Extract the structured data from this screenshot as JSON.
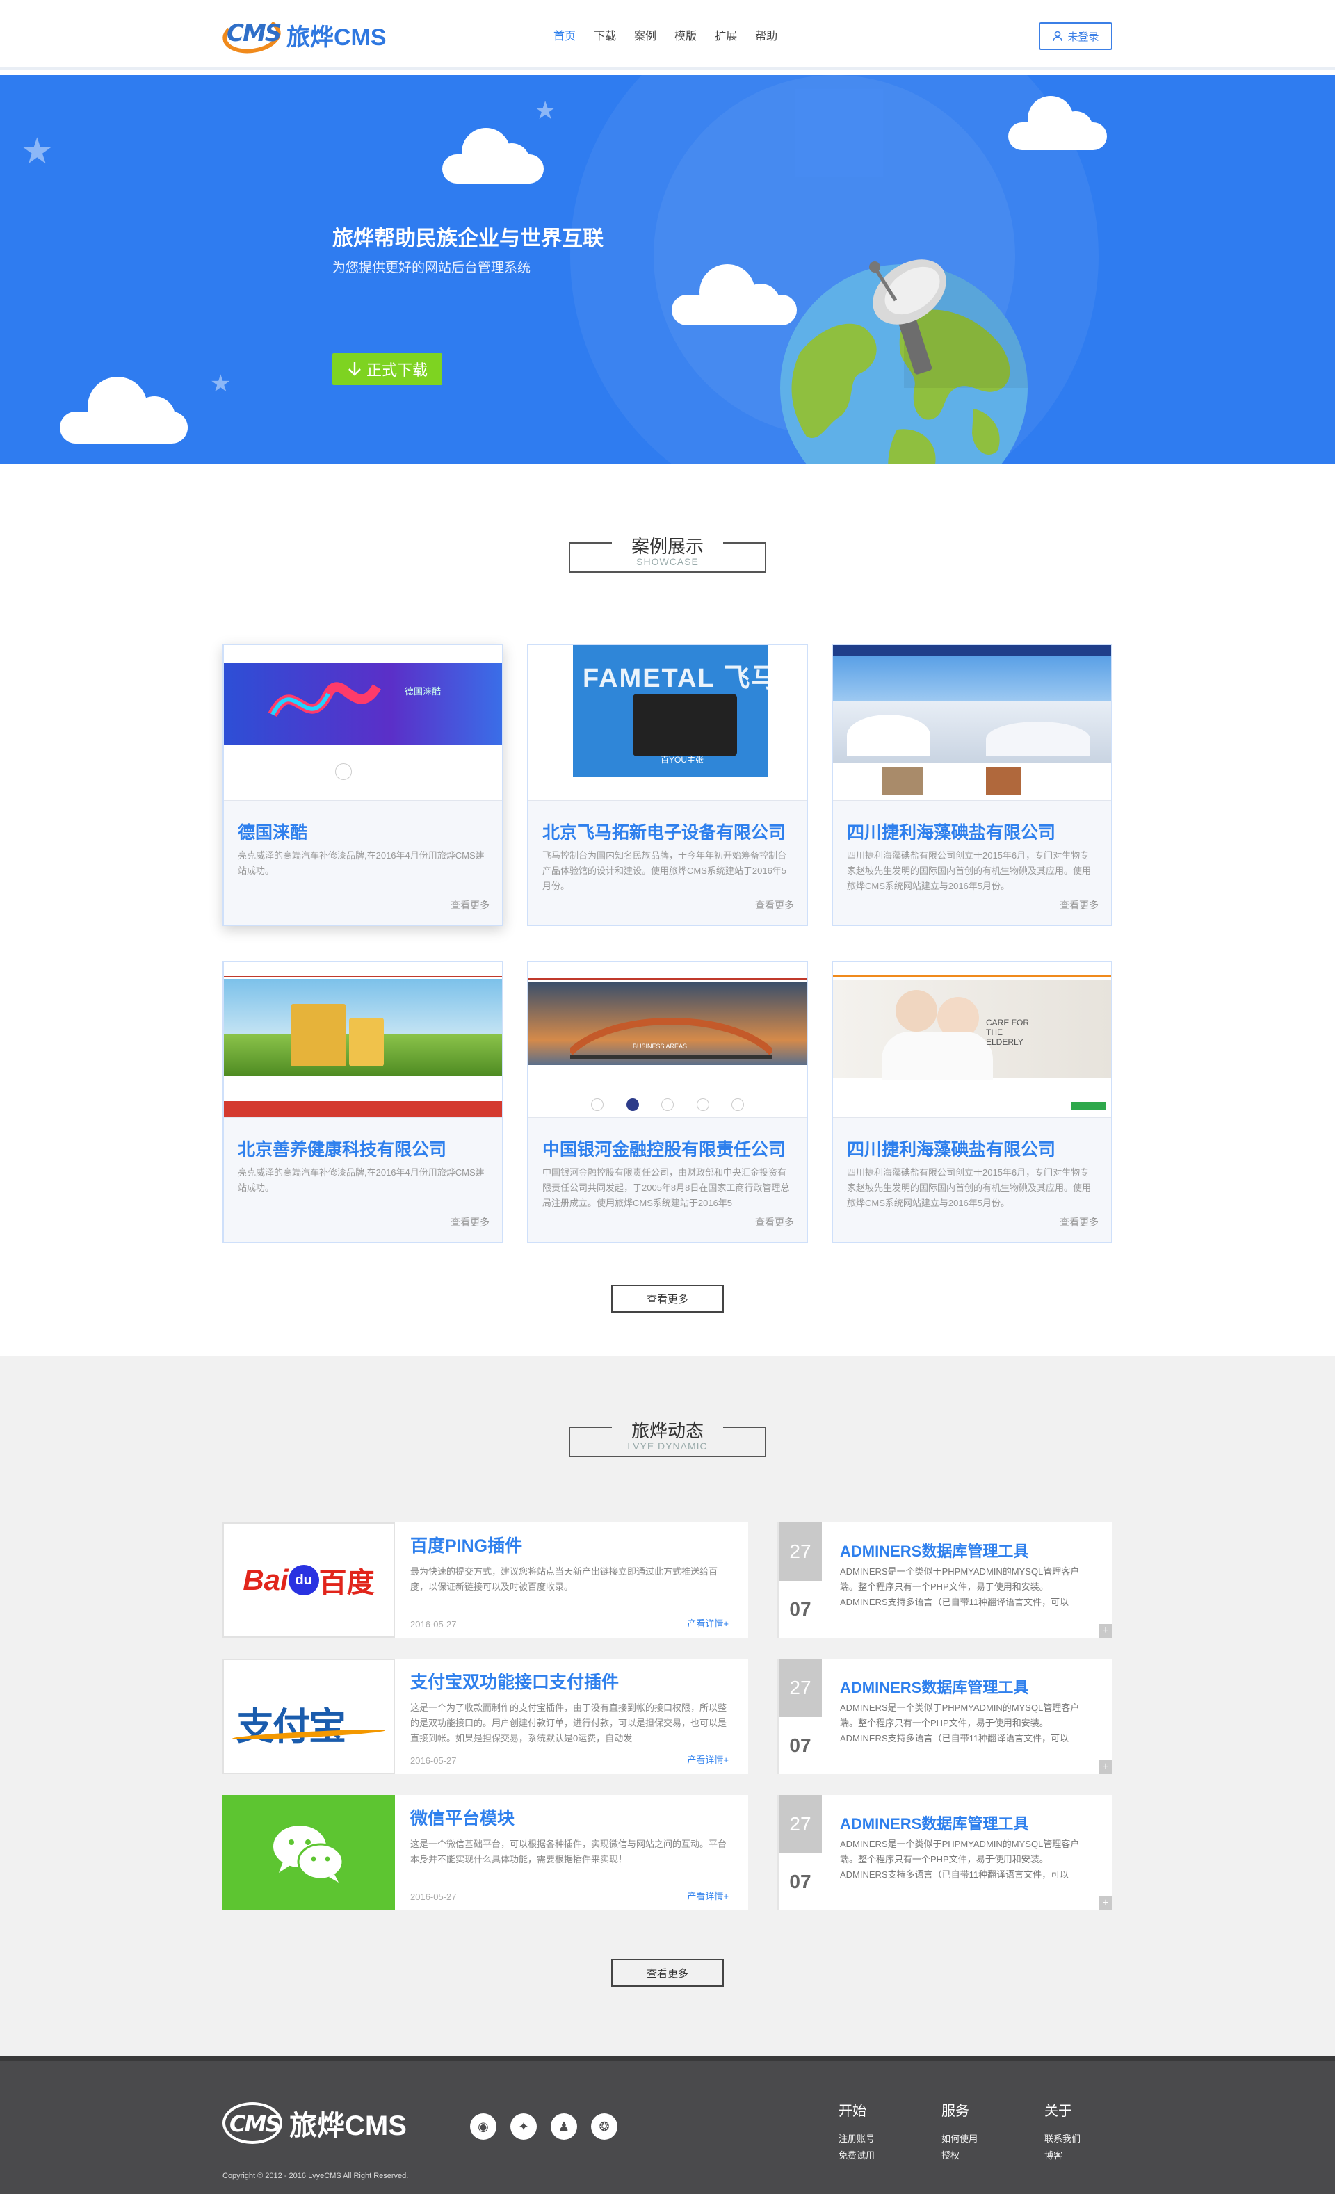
{
  "header": {
    "logo_text": "旅烨CMS",
    "logo_badge": "CMS",
    "nav": [
      "首页",
      "下载",
      "案例",
      "模版",
      "扩展",
      "帮助"
    ],
    "login": "未登录"
  },
  "banner": {
    "title": "旅烨帮助民族企业与世界互联",
    "subtitle": "为您提供更好的网站后台管理系统",
    "download": "正式下载"
  },
  "showcase": {
    "title": "案例展示",
    "subtitle": "SHOWCASE",
    "more_label": "查看更多",
    "items": [
      {
        "name": "德国涞酷",
        "desc": "亮克威泽的高端汽车补修漆品牌,在2016年4月份用旅烨CMS建站成功。",
        "more": "查看更多"
      },
      {
        "name": "北京飞马拓新电子设备有限公司",
        "desc": "飞马控制台为国内知名民族品牌，于今年年初开始筹备控制台产品体验馆的设计和建设。使用旅烨CMS系统建站于2016年5月份。",
        "more": "查看更多"
      },
      {
        "name": "四川捷利海藻碘盐有限公司",
        "desc": "四川捷利海藻碘盐有限公司创立于2015年6月，专门对生物专家赵坡先生发明的国际国内首创的有机生物碘及其应用。使用旅烨CMS系统网站建立与2016年5月份。",
        "more": "查看更多"
      },
      {
        "name": "北京善养健康科技有限公司",
        "desc": "亮克威泽的高端汽车补修漆品牌,在2016年4月份用旅烨CMS建站成功。",
        "more": "查看更多"
      },
      {
        "name": "中国银河金融控股有限责任公司",
        "desc": "中国银河金融控股有限责任公司，由财政部和中央汇金投资有限责任公司共同发起，于2005年8月8日在国家工商行政管理总局注册成立。使用旅烨CMS系统建站于2016年5",
        "more": "查看更多"
      },
      {
        "name": "四川捷利海藻碘盐有限公司",
        "desc": "四川捷利海藻碘盐有限公司创立于2015年6月，专门对生物专家赵坡先生发明的国际国内首创的有机生物碘及其应用。使用旅烨CMS系统网站建立与2016年5月份。",
        "more": "查看更多"
      }
    ],
    "thumbs": {
      "fametal": "FAMETAL 飞马",
      "fametal_sub": "百YOU主张",
      "laiku": "德国涞酷",
      "care": "CARE FOR THE ELDERLY",
      "yinhe_btn": "BUSINESS AREAS"
    }
  },
  "dynamic": {
    "title": "旅烨动态",
    "subtitle": "LVYE DYNAMIC",
    "more_label": "查看更多",
    "left": [
      {
        "logo": "Bai百度",
        "title": "百度PING插件",
        "desc": "最为快速的提交方式，建议您将站点当天新产出链接立即通过此方式推送给百度，以保证新链接可以及时被百度收录。",
        "date": "2016-05-27",
        "detail": "产看详情+"
      },
      {
        "logo": "支付宝",
        "title": "支付宝双功能接口支付插件",
        "desc": "这是一个为了收款而制作的支付宝插件，由于没有直接到帐的接口权限，所以整的是双功能接口的。用户创建付款订单，进行付款，可以是担保交易，也可以是直接到帐。如果是担保交易，系统默认是0运费，自动发",
        "date": "2016-05-27",
        "detail": "产看详情+"
      },
      {
        "logo": "wechat",
        "title": "微信平台模块",
        "desc": "这是一个微信基础平台，可以根据各种插件，实现微信与网站之间的互动。平台本身并不能实现什么具体功能，需要根据插件来实现！",
        "date": "2016-05-27",
        "detail": "产看详情+"
      }
    ],
    "right": [
      {
        "day": "27",
        "month": "07",
        "title": "ADMINERS数据库管理工具",
        "desc": "ADMINERS是一个类似于PHPMYADMIN的MYSQL管理客户端。整个程序只有一个PHP文件，易于使用和安装。ADMINERS支持多语言（已自带11种翻译语言文件，可以"
      },
      {
        "day": "27",
        "month": "07",
        "title": "ADMINERS数据库管理工具",
        "desc": "ADMINERS是一个类似于PHPMYADMIN的MYSQL管理客户端。整个程序只有一个PHP文件，易于使用和安装。ADMINERS支持多语言（已自带11种翻译语言文件，可以"
      },
      {
        "day": "27",
        "month": "07",
        "title": "ADMINERS数据库管理工具",
        "desc": "ADMINERS是一个类似于PHPMYADMIN的MYSQL管理客户端。整个程序只有一个PHP文件，易于使用和安装。ADMINERS支持多语言（已自带11种翻译语言文件，可以"
      }
    ]
  },
  "footer": {
    "logo_badge": "CMS",
    "logo_text": "旅烨CMS",
    "cols": [
      {
        "h": "开始",
        "items": [
          "注册账号",
          "免费试用"
        ]
      },
      {
        "h": "服务",
        "items": [
          "如何使用",
          "授权"
        ]
      },
      {
        "h": "关于",
        "items": [
          "联系我们",
          "博客"
        ]
      }
    ],
    "copyright": "Copyright © 2012 - 2016 LvyeCMS All Right Reserved."
  },
  "colors": {
    "primary": "#2f80ed",
    "banner": "#2f7cf0",
    "download": "#7ed321",
    "footer": "#4a4a4c"
  }
}
